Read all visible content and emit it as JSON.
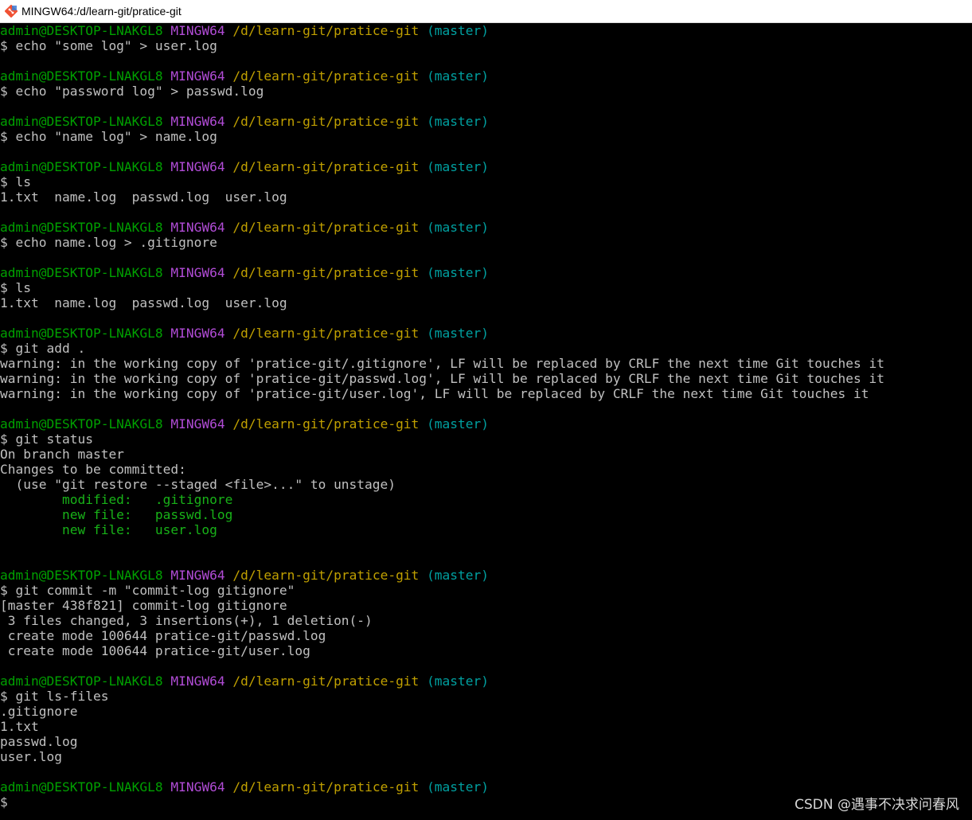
{
  "window": {
    "title": "MINGW64:/d/learn-git/pratice-git",
    "icon": "git-bash-icon"
  },
  "colors": {
    "background": "#000000",
    "prompt_user": "#00a000",
    "prompt_system": "#b14cd6",
    "prompt_path": "#c0a000",
    "prompt_branch": "#00a0a0",
    "output": "#c0c0c0",
    "status_green": "#18b218"
  },
  "terminal": {
    "lines": [
      {
        "type": "prompt",
        "user": "admin@DESKTOP-LNAKGL8",
        "system": "MINGW64",
        "path": "/d/learn-git/pratice-git",
        "branch": "(master)"
      },
      {
        "type": "command",
        "text": "$ echo \"some log\" > user.log"
      },
      {
        "type": "blank"
      },
      {
        "type": "prompt",
        "user": "admin@DESKTOP-LNAKGL8",
        "system": "MINGW64",
        "path": "/d/learn-git/pratice-git",
        "branch": "(master)"
      },
      {
        "type": "command",
        "text": "$ echo \"password log\" > passwd.log"
      },
      {
        "type": "blank"
      },
      {
        "type": "prompt",
        "user": "admin@DESKTOP-LNAKGL8",
        "system": "MINGW64",
        "path": "/d/learn-git/pratice-git",
        "branch": "(master)"
      },
      {
        "type": "command",
        "text": "$ echo \"name log\" > name.log"
      },
      {
        "type": "blank"
      },
      {
        "type": "prompt",
        "user": "admin@DESKTOP-LNAKGL8",
        "system": "MINGW64",
        "path": "/d/learn-git/pratice-git",
        "branch": "(master)"
      },
      {
        "type": "command",
        "text": "$ ls"
      },
      {
        "type": "output",
        "text": "1.txt  name.log  passwd.log  user.log"
      },
      {
        "type": "blank"
      },
      {
        "type": "prompt",
        "user": "admin@DESKTOP-LNAKGL8",
        "system": "MINGW64",
        "path": "/d/learn-git/pratice-git",
        "branch": "(master)"
      },
      {
        "type": "command",
        "text": "$ echo name.log > .gitignore"
      },
      {
        "type": "blank"
      },
      {
        "type": "prompt",
        "user": "admin@DESKTOP-LNAKGL8",
        "system": "MINGW64",
        "path": "/d/learn-git/pratice-git",
        "branch": "(master)"
      },
      {
        "type": "command",
        "text": "$ ls"
      },
      {
        "type": "output",
        "text": "1.txt  name.log  passwd.log  user.log"
      },
      {
        "type": "blank"
      },
      {
        "type": "prompt",
        "user": "admin@DESKTOP-LNAKGL8",
        "system": "MINGW64",
        "path": "/d/learn-git/pratice-git",
        "branch": "(master)"
      },
      {
        "type": "command",
        "text": "$ git add ."
      },
      {
        "type": "output",
        "text": "warning: in the working copy of 'pratice-git/.gitignore', LF will be replaced by CRLF the next time Git touches it"
      },
      {
        "type": "output",
        "text": "warning: in the working copy of 'pratice-git/passwd.log', LF will be replaced by CRLF the next time Git touches it"
      },
      {
        "type": "output",
        "text": "warning: in the working copy of 'pratice-git/user.log', LF will be replaced by CRLF the next time Git touches it"
      },
      {
        "type": "blank"
      },
      {
        "type": "prompt",
        "user": "admin@DESKTOP-LNAKGL8",
        "system": "MINGW64",
        "path": "/d/learn-git/pratice-git",
        "branch": "(master)"
      },
      {
        "type": "command",
        "text": "$ git status"
      },
      {
        "type": "output",
        "text": "On branch master"
      },
      {
        "type": "output",
        "text": "Changes to be committed:"
      },
      {
        "type": "output",
        "text": "  (use \"git restore --staged <file>...\" to unstage)"
      },
      {
        "type": "green",
        "text": "        modified:   .gitignore"
      },
      {
        "type": "green",
        "text": "        new file:   passwd.log"
      },
      {
        "type": "green",
        "text": "        new file:   user.log"
      },
      {
        "type": "blank"
      },
      {
        "type": "blank"
      },
      {
        "type": "prompt",
        "user": "admin@DESKTOP-LNAKGL8",
        "system": "MINGW64",
        "path": "/d/learn-git/pratice-git",
        "branch": "(master)"
      },
      {
        "type": "command",
        "text": "$ git commit -m \"commit-log gitignore\""
      },
      {
        "type": "output",
        "text": "[master 438f821] commit-log gitignore"
      },
      {
        "type": "output",
        "text": " 3 files changed, 3 insertions(+), 1 deletion(-)"
      },
      {
        "type": "output",
        "text": " create mode 100644 pratice-git/passwd.log"
      },
      {
        "type": "output",
        "text": " create mode 100644 pratice-git/user.log"
      },
      {
        "type": "blank"
      },
      {
        "type": "prompt",
        "user": "admin@DESKTOP-LNAKGL8",
        "system": "MINGW64",
        "path": "/d/learn-git/pratice-git",
        "branch": "(master)"
      },
      {
        "type": "command",
        "text": "$ git ls-files"
      },
      {
        "type": "output",
        "text": ".gitignore"
      },
      {
        "type": "output",
        "text": "1.txt"
      },
      {
        "type": "output",
        "text": "passwd.log"
      },
      {
        "type": "output",
        "text": "user.log"
      },
      {
        "type": "blank"
      },
      {
        "type": "prompt",
        "user": "admin@DESKTOP-LNAKGL8",
        "system": "MINGW64",
        "path": "/d/learn-git/pratice-git",
        "branch": "(master)"
      },
      {
        "type": "command",
        "text": "$"
      }
    ]
  },
  "watermark": "CSDN @遇事不决求问春风"
}
